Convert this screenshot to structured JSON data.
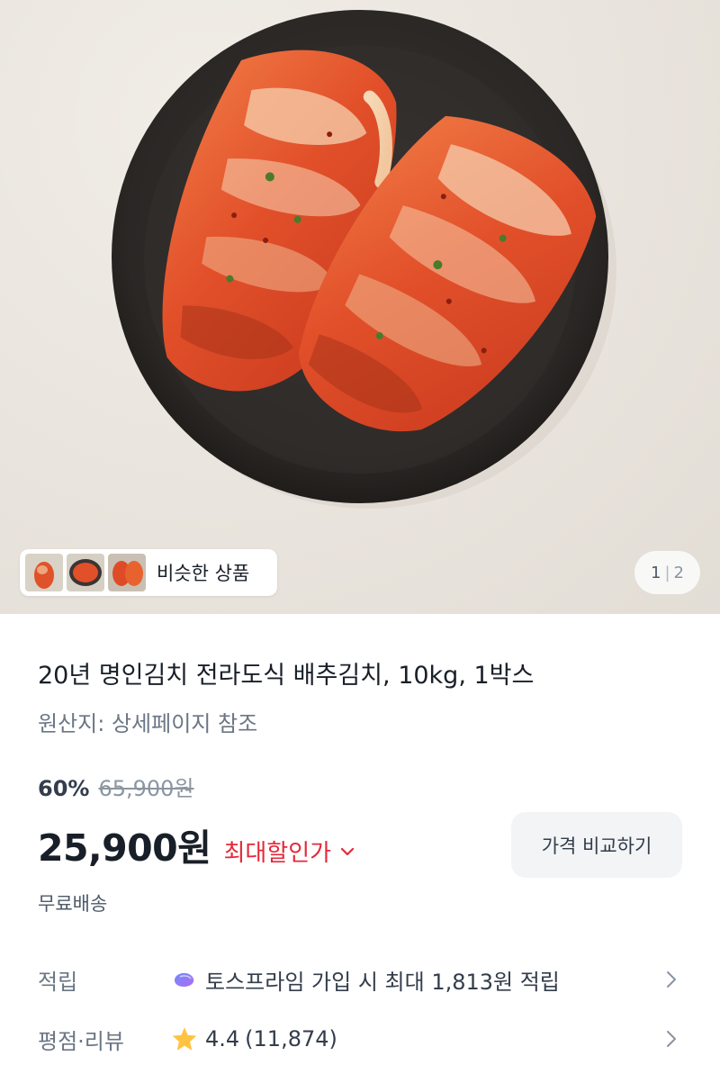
{
  "hero": {
    "similar_label": "비슷한 상품",
    "thumbnails": [
      "kimchi-thumb-1",
      "kimchi-thumb-2",
      "kimchi-thumb-3"
    ],
    "pager": {
      "current": "1",
      "separator": "|",
      "total": "2"
    }
  },
  "product": {
    "title": "20년 명인김치 전라도식 배추김치, 10kg, 1박스",
    "origin": "원산지: 상세페이지 참조"
  },
  "pricing": {
    "discount_rate": "60%",
    "original_price": "65,900원",
    "sale_price": "25,900원",
    "max_discount_label": "최대할인가",
    "compare_button": "가격 비교하기",
    "shipping": "무료배송"
  },
  "points": {
    "label": "적립",
    "value": "토스프라임 가입 시 최대 1,813원 적립",
    "icon": "toss-prime-icon"
  },
  "review": {
    "label": "평점·리뷰",
    "rating": "4.4",
    "count": "(11,874)",
    "icon": "star-icon"
  },
  "colors": {
    "accent_red": "#e42939",
    "star": "#ffc342",
    "text_primary": "#191f28",
    "text_secondary": "#6b7684",
    "button_bg": "#f2f4f6"
  }
}
